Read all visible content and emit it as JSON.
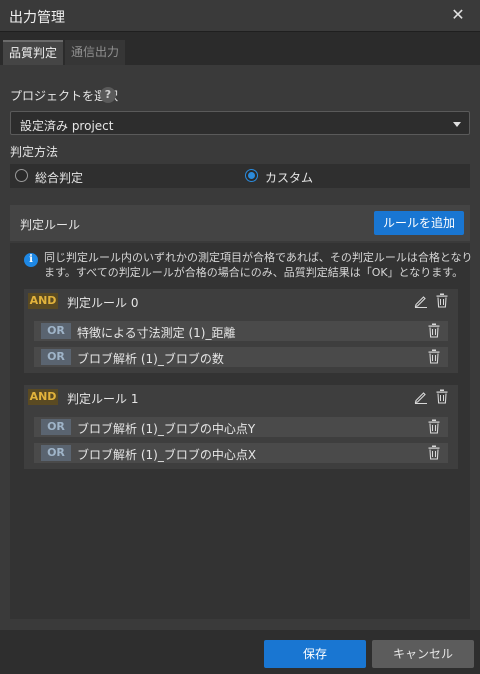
{
  "window": {
    "title": "出力管理",
    "close_icon": "close-icon"
  },
  "tabs": [
    {
      "label": "品質判定",
      "active": true
    },
    {
      "label": "通信出力",
      "active": false
    }
  ],
  "project": {
    "label": "プロジェクトを選択",
    "help": "?",
    "selected": "設定済み project"
  },
  "method": {
    "label": "判定方法",
    "options": [
      {
        "label": "総合判定",
        "checked": false
      },
      {
        "label": "カスタム",
        "checked": true
      }
    ]
  },
  "rules": {
    "header": "判定ルール",
    "add_button": "ルールを追加",
    "info_icon": "i",
    "info_text": "同じ判定ルール内のいずれかの測定項目が合格であれば、その判定ルールは合格となります。すべての判定ルールが合格の場合にのみ、品質判定結果は「OK」となります。",
    "groups": [
      {
        "badge": "AND",
        "name": "判定ルール 0",
        "items": [
          {
            "badge": "OR",
            "name": "特徴による寸法測定 (1)_距離"
          },
          {
            "badge": "OR",
            "name": "ブロブ解析 (1)_ブロブの数"
          }
        ]
      },
      {
        "badge": "AND",
        "name": "判定ルール 1",
        "items": [
          {
            "badge": "OR",
            "name": "ブロブ解析 (1)_ブロブの中心点Y"
          },
          {
            "badge": "OR",
            "name": "ブロブ解析 (1)_ブロブの中心点X"
          }
        ]
      }
    ]
  },
  "footer": {
    "save": "保存",
    "cancel": "キャンセル"
  },
  "colors": {
    "accent": "#1976d2",
    "and_badge": "#e2b33c",
    "or_badge": "#9fb4c8"
  }
}
